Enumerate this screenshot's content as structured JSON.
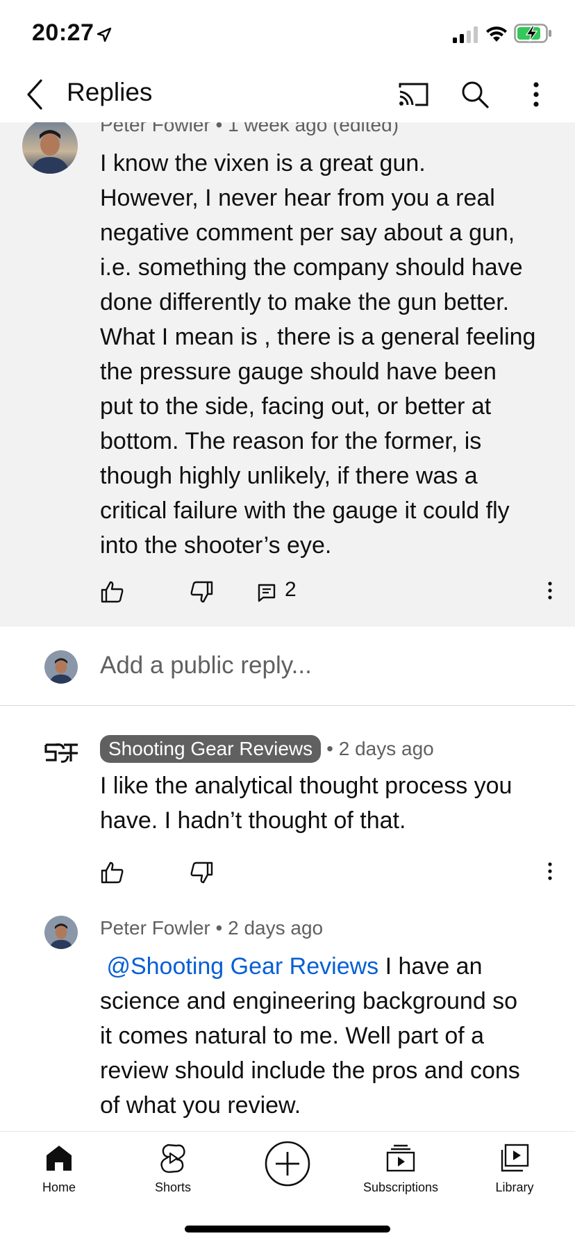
{
  "status_bar": {
    "time": "20:27"
  },
  "header": {
    "title": "Replies"
  },
  "parent_comment": {
    "author": "Peter Fowler",
    "time": "1 week ago (edited)",
    "text_lines": [
      "I know the vixen is a great gun.",
      "However, I never hear from you a real",
      "negative comment per say about a gun,",
      "i.e. something the company should have",
      "done differently to make the gun better.",
      "What I mean is , there is a general feeling",
      "the pressure gauge should have been",
      "put to the side, facing out, or better at",
      "bottom.  The reason for the former, is",
      "though highly unlikely, if there was a",
      "critical failure with the gauge it could fly",
      "into the shooter’s eye."
    ],
    "reply_count": "2"
  },
  "add_reply": {
    "placeholder": "Add a public reply..."
  },
  "replies": [
    {
      "author": "Shooting Gear Reviews",
      "time": "2 days ago",
      "text_lines": [
        "I like the analytical thought process you",
        "have. I hadn’t thought of that."
      ]
    },
    {
      "author": "Peter Fowler",
      "time": "2 days ago",
      "mention": "@Shooting Gear Reviews",
      "text_first_line_rest": " I have an",
      "text_lines": [
        "science and engineering background so",
        "it comes natural to me. Well part of a",
        "review should include the pros and cons",
        "of what you review."
      ]
    }
  ],
  "bottom_nav": {
    "items": [
      {
        "label": "Home",
        "icon": "home-icon"
      },
      {
        "label": "Shorts",
        "icon": "shorts-icon"
      },
      {
        "label": "",
        "icon": "create-icon"
      },
      {
        "label": "Subscriptions",
        "icon": "subscriptions-icon"
      },
      {
        "label": "Library",
        "icon": "library-icon"
      }
    ]
  },
  "colors": {
    "accent_link": "#065fd4",
    "secondary_text": "#606060",
    "highlight_bg": "#f2f2f2",
    "battery_green": "#34c759"
  }
}
